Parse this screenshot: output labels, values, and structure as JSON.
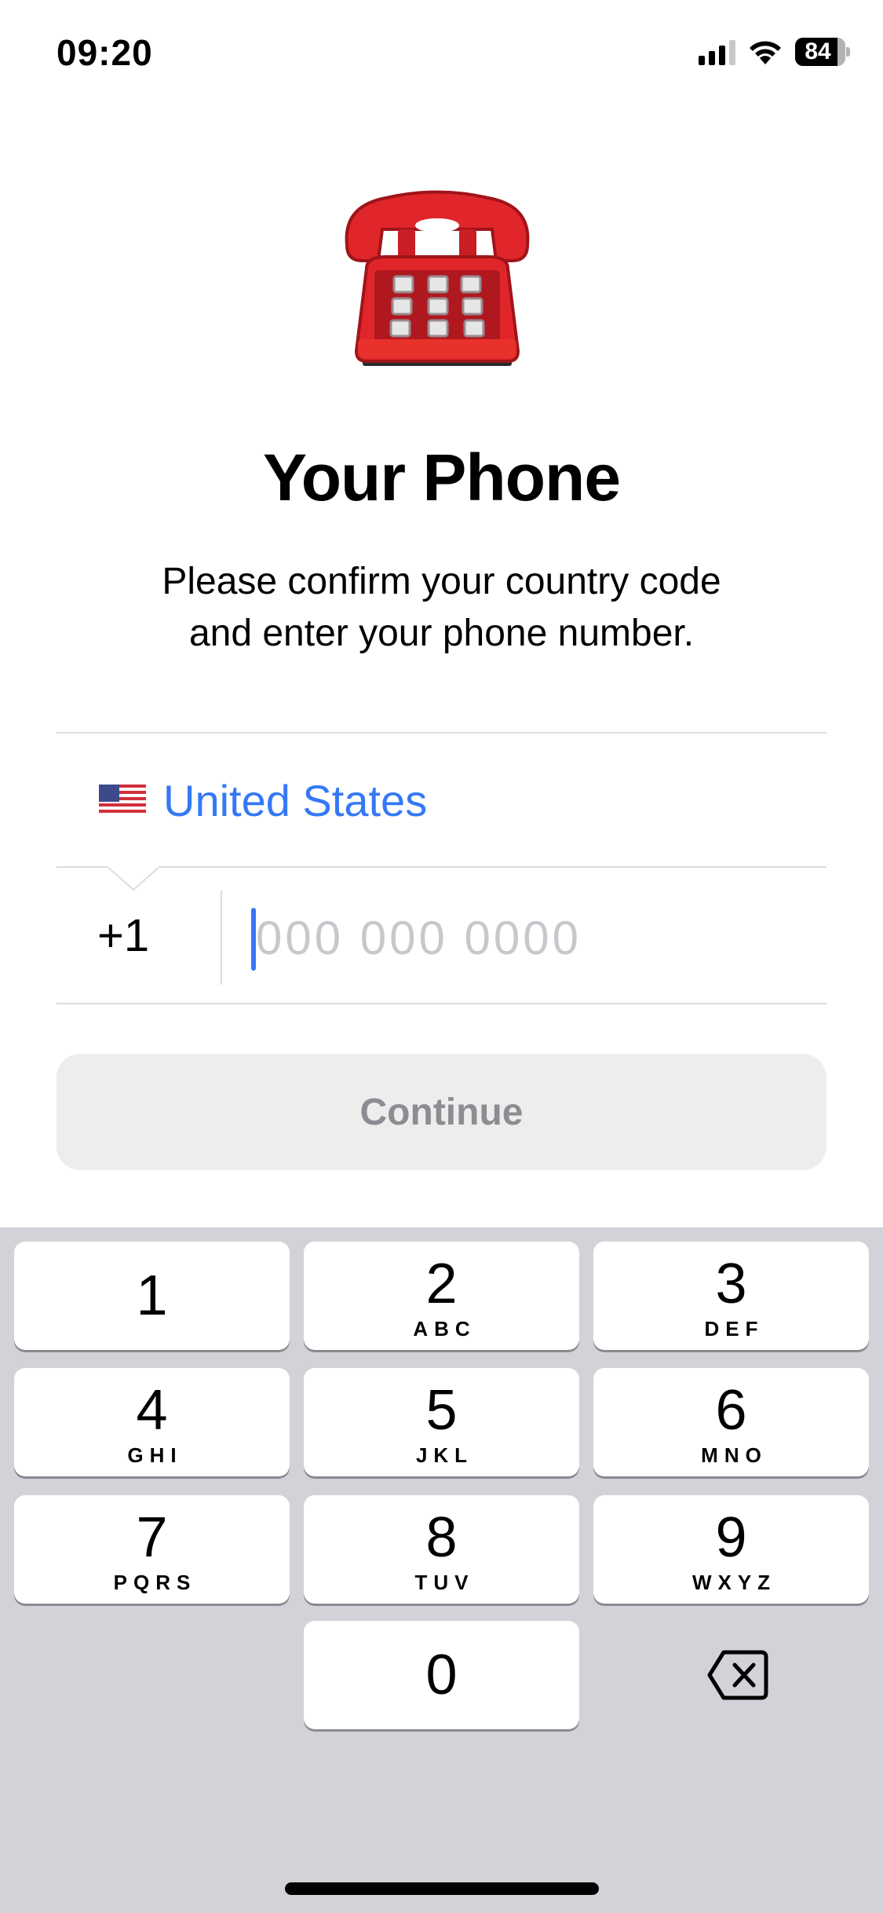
{
  "status_bar": {
    "time": "09:20",
    "signal_bars_active": 3,
    "signal_bars_total": 4,
    "wifi_icon": "wifi-icon",
    "battery_level": 84,
    "battery_label": "84"
  },
  "hero": {
    "icon": "telephone-icon",
    "title": "Your Phone",
    "subtitle_line1": "Please confirm your country code",
    "subtitle_line2": "and enter your phone number."
  },
  "form": {
    "country": {
      "flag_icon": "us-flag-icon",
      "name": "United States"
    },
    "country_code": "+1",
    "phone_input": {
      "value": "",
      "placeholder": "000 000 0000"
    },
    "continue_label": "Continue",
    "continue_enabled": false
  },
  "keyboard": {
    "keys": [
      {
        "digit": "1",
        "letters": ""
      },
      {
        "digit": "2",
        "letters": "ABC"
      },
      {
        "digit": "3",
        "letters": "DEF"
      },
      {
        "digit": "4",
        "letters": "GHI"
      },
      {
        "digit": "5",
        "letters": "JKL"
      },
      {
        "digit": "6",
        "letters": "MNO"
      },
      {
        "digit": "7",
        "letters": "PQRS"
      },
      {
        "digit": "8",
        "letters": "TUV"
      },
      {
        "digit": "9",
        "letters": "WXYZ"
      },
      {
        "digit": "0",
        "letters": ""
      }
    ],
    "delete_icon": "backspace-icon"
  },
  "colors": {
    "accent": "#3478f6",
    "placeholder": "#c7c7cc",
    "button_disabled_bg": "#ededed",
    "button_disabled_text": "#8d8c92",
    "keyboard_bg": "#d1d3d9"
  }
}
